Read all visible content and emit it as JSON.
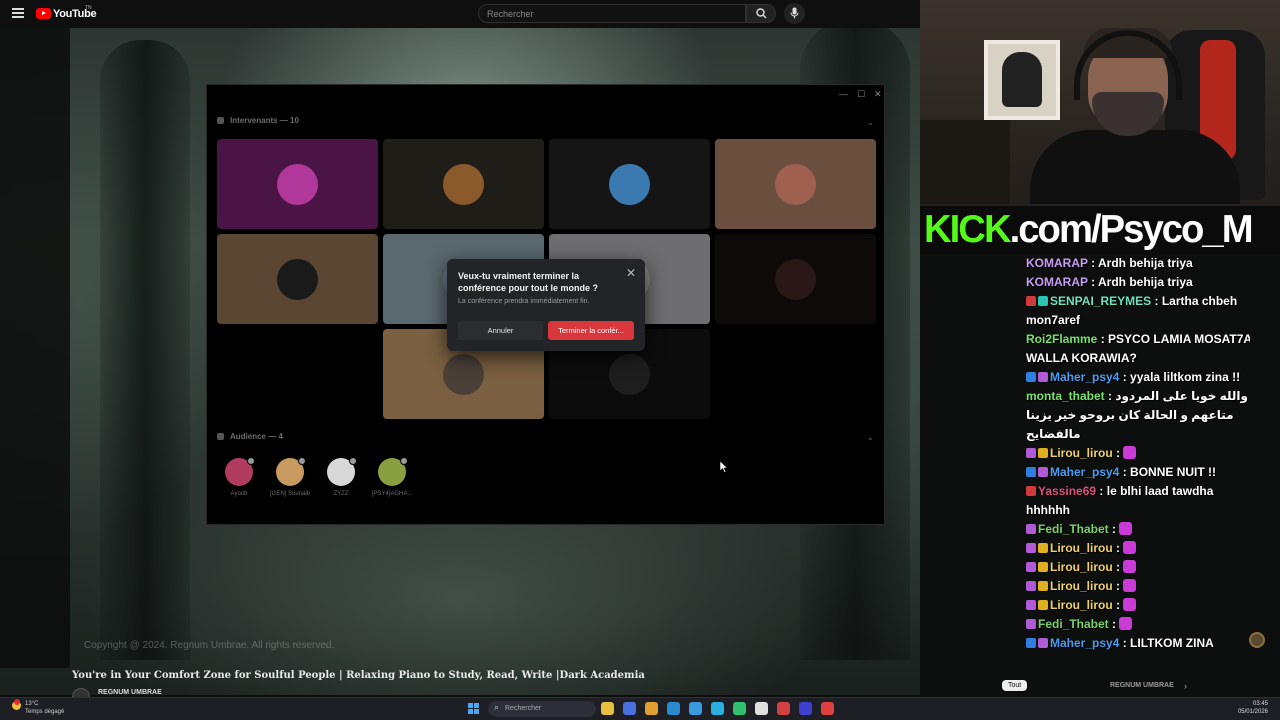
{
  "youtube": {
    "logo_text": "YouTube",
    "logo_sup": "TN",
    "search_placeholder": "Rechercher",
    "video_title": "You're in Your Comfort Zone for Soulful People | Relaxing Piano to Study, Read, Write |Dark Academia",
    "channel_name": "REGNUM UMBRAE",
    "copyright": "Copyright @ 2024. Regnum Umbrae. All rights reserved."
  },
  "discord": {
    "speakers_label": "Intervenants — 10",
    "audience_label": "Audience — 4",
    "speakers": [
      {
        "color": "#4a1446"
      },
      {
        "color": "#1f1d18"
      },
      {
        "color": "#151515"
      },
      {
        "color": "#6b4f3e"
      },
      {
        "color": "#5a4632"
      },
      {
        "color": "#5a6870"
      },
      {
        "color": "#6e6e70"
      },
      {
        "color": "#0f0a0a"
      },
      {
        "color": "#7a6040"
      },
      {
        "color": "#0c0c0c"
      }
    ],
    "audience": [
      {
        "name": "Ayoub",
        "color": "#b03a60"
      },
      {
        "name": "[GEN] Sounaib",
        "color": "#c89a60"
      },
      {
        "name": "ZYZZ",
        "color": "#d8d8d8"
      },
      {
        "name": "[PSY4]AGHA...",
        "color": "#8aa040"
      }
    ]
  },
  "modal": {
    "title": "Veux-tu vraiment terminer la conférence pour tout le monde ?",
    "description": "La conférence prendra immédiatement fin.",
    "cancel_label": "Annuler",
    "confirm_label": "Terminer la confér..."
  },
  "stream": {
    "banner_kick": "KICK",
    "banner_rest": ".com/Psyco_M"
  },
  "chat": {
    "messages": [
      {
        "user": "KOMARAP",
        "color": "#c99cf4",
        "badges": [],
        "text": "Ardh behija triya"
      },
      {
        "user": "KOMARAP",
        "color": "#c99cf4",
        "badges": [],
        "text": "Ardh behija triya"
      },
      {
        "user": "SENPAI_REYMES",
        "color": "#6fe0c0",
        "badges": [
          "b-red",
          "b-teal"
        ],
        "text": "Lartha chbeh mon7aref"
      },
      {
        "user": "Roi2Flamme",
        "color": "#78e06a",
        "badges": [],
        "text": "PSYCO LAMIA MOSAT7A WALLA KORAWIA?"
      },
      {
        "user": "Maher_psy4",
        "color": "#4a9cf0",
        "badges": [
          "b-blue",
          "b-purple"
        ],
        "text": "yyala liltkom zina !!"
      },
      {
        "user": "monta_thabet",
        "color": "#78e06a",
        "badges": [],
        "text": "والله خويا على المردود متاعهم و الحالة كان بروحو خير يزينا مالفضايح"
      },
      {
        "user": "Lirou_lirou",
        "color": "#f0d060",
        "badges": [
          "b-purple",
          "b-gold"
        ],
        "text": ""
      },
      {
        "user": "Maher_psy4",
        "color": "#4a9cf0",
        "badges": [
          "b-blue",
          "b-purple"
        ],
        "text": "BONNE NUIT !!"
      },
      {
        "user": "Yassine69",
        "color": "#e0507a",
        "badges": [
          "b-red"
        ],
        "text": "le blhi laad tawdha hhhhhh"
      },
      {
        "user": "Fedi_Thabet",
        "color": "#7ad06a",
        "badges": [
          "b-purple"
        ],
        "text": ""
      },
      {
        "user": "Lirou_lirou",
        "color": "#f0d060",
        "badges": [
          "b-purple",
          "b-gold"
        ],
        "text": ""
      },
      {
        "user": "Lirou_lirou",
        "color": "#f0d060",
        "badges": [
          "b-purple",
          "b-gold"
        ],
        "text": ""
      },
      {
        "user": "Lirou_lirou",
        "color": "#f0d060",
        "badges": [
          "b-purple",
          "b-gold"
        ],
        "text": ""
      },
      {
        "user": "Lirou_lirou",
        "color": "#f0d060",
        "badges": [
          "b-purple",
          "b-gold"
        ],
        "text": ""
      },
      {
        "user": "Fedi_Thabet",
        "color": "#7ad06a",
        "badges": [
          "b-purple"
        ],
        "text": ""
      },
      {
        "user": "Maher_psy4",
        "color": "#4a9cf0",
        "badges": [
          "b-blue",
          "b-purple"
        ],
        "text": "LILTKOM ZINA"
      }
    ],
    "tout_label": "Tout",
    "mini_label": "REGNUM UMBRAE"
  },
  "taskbar": {
    "temp": "13°C",
    "weather": "Temps dégagé",
    "search_label": "Rechercher",
    "time": "03:45",
    "date": "05/01/2026",
    "apps": [
      "#e8c040",
      "#4a70e0",
      "#e0a030",
      "#2a8ad0",
      "#3a9ae0",
      "#2ab0e0",
      "#30c070",
      "#e0e0e0",
      "#d04040",
      "#4040d0",
      "#e04040"
    ]
  }
}
